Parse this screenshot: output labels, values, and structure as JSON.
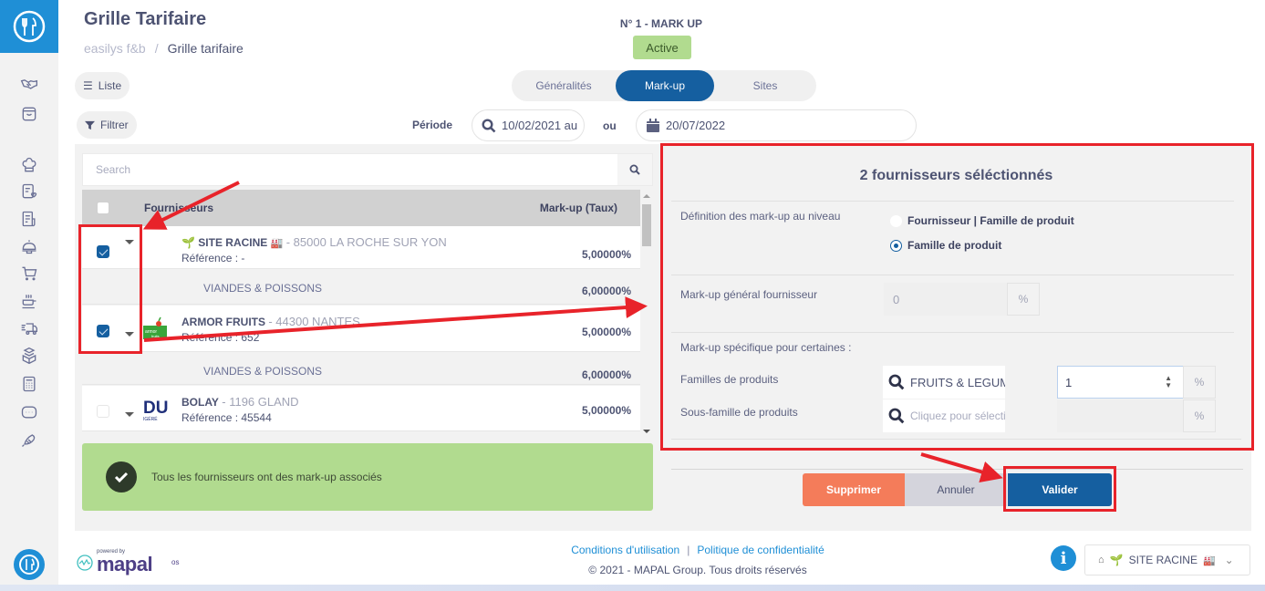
{
  "header": {
    "title": "Grille Tarifaire",
    "breadcrumb": [
      "easilys f&b",
      "Grille tarifaire"
    ],
    "grid_name": "N° 1 - MARK UP",
    "status": "Active"
  },
  "toolbar": {
    "list_label": "Liste",
    "filter_label": "Filtrer"
  },
  "tabs": [
    {
      "label": "Généralités",
      "active": false
    },
    {
      "label": "Mark-up",
      "active": true
    },
    {
      "label": "Sites",
      "active": false
    }
  ],
  "period": {
    "label": "Période",
    "range_value": "10/02/2021 au",
    "or_label": "ou",
    "date_value": "20/07/2022"
  },
  "supplier_list": {
    "search_placeholder": "Search",
    "columns": {
      "supplier": "Fournisseurs",
      "rate": "Mark-up (Taux)"
    },
    "rows": [
      {
        "name": "SITE RACINE",
        "location": "85000 LA ROCHE SUR YON",
        "reference": "Référence : -",
        "rate": "5,00000%",
        "checked": true,
        "families": [
          {
            "name": "VIANDES & POISSONS",
            "rate": "6,00000%"
          }
        ]
      },
      {
        "name": "ARMOR FRUITS",
        "location": "44300 NANTES",
        "reference": "Référence : 652",
        "rate": "5,00000%",
        "checked": true,
        "families": [
          {
            "name": "VIANDES & POISSONS",
            "rate": "6,00000%"
          }
        ]
      },
      {
        "name": "BOLAY",
        "location": "1196 GLAND",
        "reference": "Référence : 45544",
        "rate": "5,00000%",
        "checked": false,
        "families": []
      }
    ],
    "success_message": "Tous les fournisseurs ont des mark-up associés"
  },
  "edit_panel": {
    "title": "2 fournisseurs séléctionnés",
    "level_label": "Définition des mark-up au niveau",
    "level_options": [
      {
        "label": "Fournisseur | Famille de produit",
        "selected": false
      },
      {
        "label": "Famille de produit",
        "selected": true
      }
    ],
    "general_label": "Mark-up général fournisseur",
    "general_value": "0",
    "percent_symbol": "%",
    "specific_label": "Mark-up spécifique pour certaines :",
    "family_label": "Familles de produits",
    "family_value": "FRUITS & LEGUMES",
    "family_rate": "1",
    "subfamily_label": "Sous-famille de produits",
    "subfamily_placeholder": "Cliquez pour sélection"
  },
  "actions": {
    "delete": "Supprimer",
    "cancel": "Annuler",
    "validate": "Valider"
  },
  "footer": {
    "powered_by": "powered by",
    "brand": "mapal",
    "brand_suffix": "os",
    "terms": "Conditions d'utilisation",
    "privacy": "Politique de confidentialité",
    "separator": "|",
    "copyright": "© 2021 - MAPAL Group. Tous droits réservés",
    "site_selector": "SITE RACINE"
  },
  "colors": {
    "primary": "#155fa0",
    "accent_blue": "#1f8fd6",
    "success": "#b1db8f",
    "danger": "#f47c5a",
    "annotation": "#e8232a"
  }
}
